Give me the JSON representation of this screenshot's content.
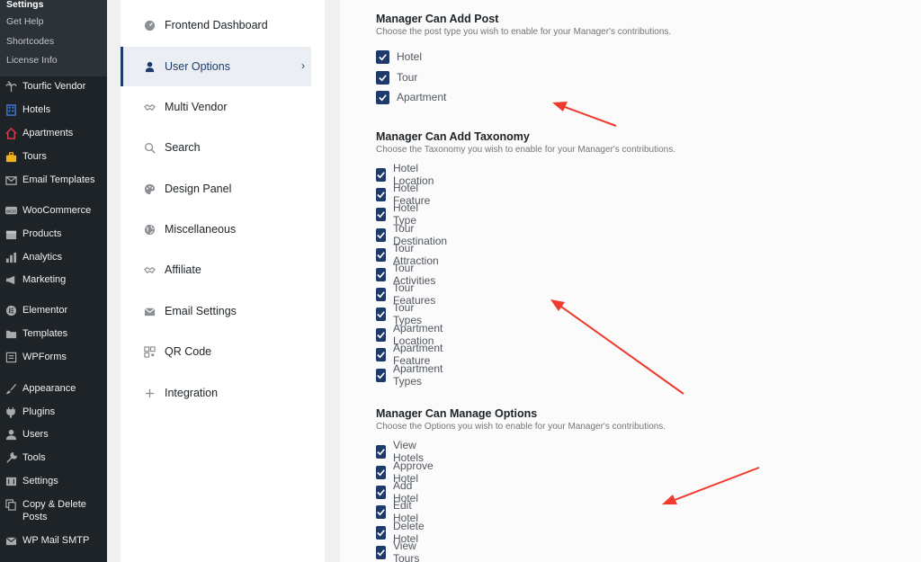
{
  "wp_admin": {
    "submenu": [
      {
        "label": "Settings",
        "current": true
      },
      {
        "label": "Get Help"
      },
      {
        "label": "Shortcodes"
      },
      {
        "label": "License Info"
      }
    ],
    "menu": [
      {
        "label": "Tourfic Vendor",
        "icon": "palm-tree-icon"
      },
      {
        "label": "Hotels",
        "icon": "building-icon"
      },
      {
        "label": "Apartments",
        "icon": "house-icon"
      },
      {
        "label": "Tours",
        "icon": "luggage-icon"
      },
      {
        "label": "Email Templates",
        "icon": "envelope-icon"
      },
      {
        "label": "WooCommerce",
        "icon": "woo-icon"
      },
      {
        "label": "Products",
        "icon": "box-icon"
      },
      {
        "label": "Analytics",
        "icon": "bar-chart-icon"
      },
      {
        "label": "Marketing",
        "icon": "megaphone-icon"
      },
      {
        "label": "Elementor",
        "icon": "elementor-icon"
      },
      {
        "label": "Templates",
        "icon": "folder-icon"
      },
      {
        "label": "WPForms",
        "icon": "form-icon"
      },
      {
        "label": "Appearance",
        "icon": "paintbrush-icon"
      },
      {
        "label": "Plugins",
        "icon": "plug-icon"
      },
      {
        "label": "Users",
        "icon": "users-icon"
      },
      {
        "label": "Tools",
        "icon": "wrench-icon"
      },
      {
        "label": "Settings",
        "icon": "sliders-icon"
      },
      {
        "label": "Copy & Delete Posts",
        "icon": "copy-icon"
      },
      {
        "label": "WP Mail SMTP",
        "icon": "mail-icon"
      }
    ]
  },
  "settings_nav": [
    {
      "label": "Frontend Dashboard",
      "icon": "dashboard-icon"
    },
    {
      "label": "User Options",
      "icon": "user-icon",
      "active": true
    },
    {
      "label": "Multi Vendor",
      "icon": "handshake-icon"
    },
    {
      "label": "Search",
      "icon": "search-icon"
    },
    {
      "label": "Design Panel",
      "icon": "palette-icon"
    },
    {
      "label": "Miscellaneous",
      "icon": "globe-icon"
    },
    {
      "label": "Affiliate",
      "icon": "handshake-icon"
    },
    {
      "label": "Email Settings",
      "icon": "envelope-icon"
    },
    {
      "label": "QR Code",
      "icon": "qr-code-icon"
    },
    {
      "label": "Integration",
      "icon": "plus-icon"
    }
  ],
  "sections": [
    {
      "title": "Manager Can Add Post",
      "description": "Choose the post type you wish to enable for your Manager's contributions.",
      "options": [
        {
          "label": "Hotel",
          "checked": true
        },
        {
          "label": "Tour",
          "checked": true
        },
        {
          "label": "Apartment",
          "checked": true
        }
      ]
    },
    {
      "title": "Manager Can Add Taxonomy",
      "description": "Choose the Taxonomy you wish to enable for your Manager's contributions.",
      "options": [
        {
          "label": "Hotel Location",
          "checked": true
        },
        {
          "label": "Hotel Feature",
          "checked": true
        },
        {
          "label": "Hotel Type",
          "checked": true
        },
        {
          "label": "Tour Destination",
          "checked": true
        },
        {
          "label": "Tour Attraction",
          "checked": true
        },
        {
          "label": "Tour Activities",
          "checked": true
        },
        {
          "label": "Tour Features",
          "checked": true
        },
        {
          "label": "Tour Types",
          "checked": true
        },
        {
          "label": "Apartment Location",
          "checked": true
        },
        {
          "label": "Apartment Feature",
          "checked": true
        },
        {
          "label": "Apartment Types",
          "checked": true
        }
      ]
    },
    {
      "title": "Manager Can Manage Options",
      "description": "Choose the Options you wish to enable for your Manager's contributions.",
      "options": [
        {
          "label": "View Hotels",
          "checked": true
        },
        {
          "label": "Approve Hotel",
          "checked": true
        },
        {
          "label": "Add Hotel",
          "checked": true
        },
        {
          "label": "Edit Hotel",
          "checked": true
        },
        {
          "label": "Delete Hotel",
          "checked": true
        },
        {
          "label": "View Tours",
          "checked": true
        }
      ]
    }
  ],
  "colors": {
    "accent": "#1e3a6b",
    "annotation_arrow": "#ee3b2b",
    "wp_sidebar": "#1d2327"
  }
}
